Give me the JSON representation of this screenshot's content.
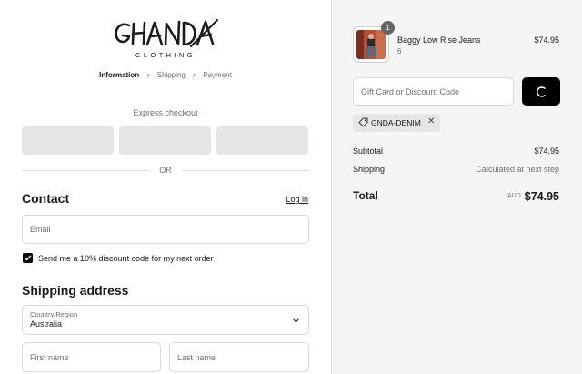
{
  "brand": {
    "logo_text": "GHANDA",
    "logo_sub": "CLOTHING"
  },
  "breadcrumb": {
    "items": [
      "Information",
      "Shipping",
      "Payment"
    ]
  },
  "express": {
    "label": "Express checkout",
    "or_text": "OR"
  },
  "contact": {
    "heading": "Contact",
    "login_label": "Log in",
    "email_placeholder": "Email",
    "newsletter_label": "Send me a 10% discount code for my next order",
    "newsletter_checked": true
  },
  "shipping": {
    "heading": "Shipping address",
    "country_label": "Country/Region",
    "country_value": "Australia",
    "first_name_placeholder": "First name",
    "last_name_placeholder": "Last name"
  },
  "cart": {
    "item": {
      "name": "Baggy Low Rise Jeans",
      "variant": "6",
      "price": "$74.95",
      "quantity": "1"
    },
    "discount_placeholder": "Gift Card or Discount Code",
    "applied_code": "GNDA-DENIM",
    "subtotal_label": "Subtotal",
    "subtotal_value": "$74.95",
    "shipping_label": "Shipping",
    "shipping_value": "Calculated at next step",
    "total_label": "Total",
    "currency": "AUD",
    "total_value": "$74.95"
  },
  "colors": {
    "accent": "#000000",
    "sidebar_bg": "#f5f5f5",
    "express_button_bg": "#e5e5e5"
  }
}
